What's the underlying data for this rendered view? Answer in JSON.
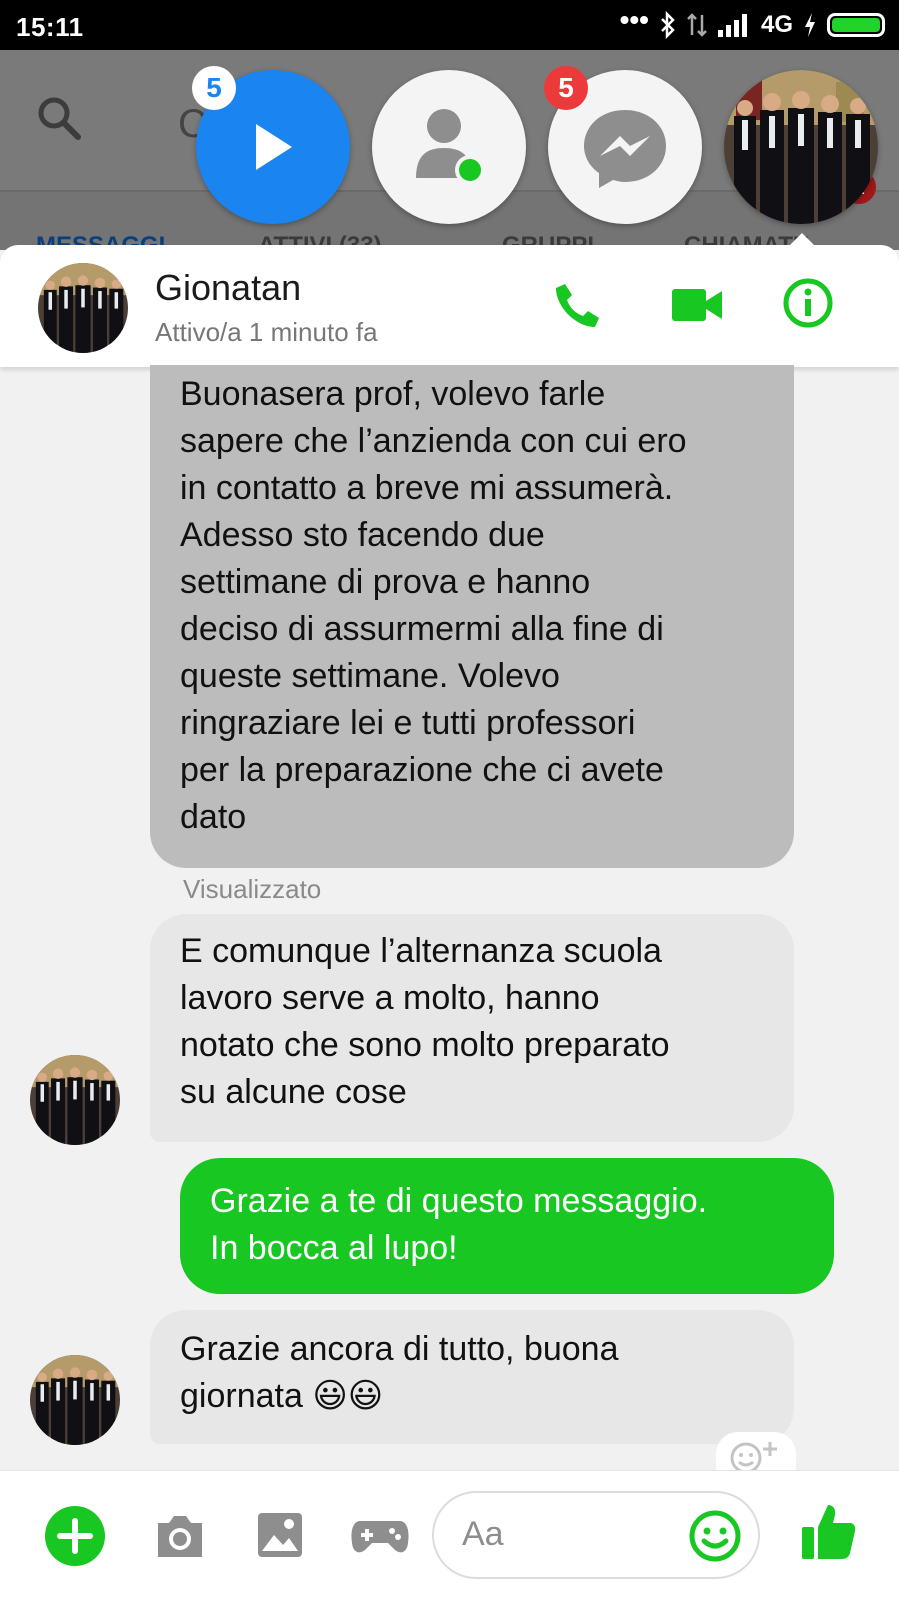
{
  "status_bar": {
    "time": "15:11",
    "dots": "•••",
    "network": "4G"
  },
  "background": {
    "tabs": [
      "MESSAGGI",
      "ATTIVI (33)",
      "GRUPPI",
      "CHIAMATE"
    ],
    "search_letter": "C",
    "calls_badge": "1"
  },
  "chat_heads": {
    "play_badge": "5",
    "messenger_badge": "5"
  },
  "header": {
    "name": "Gionatan",
    "status": "Attivo/a 1 minuto fa"
  },
  "messages": [
    {
      "from": "them",
      "text": "Buonasera prof, volevo farle\nsapere che l’anzienda con cui ero\nin contatto a breve mi assumerà.\nAdesso sto facendo due\nsettimane di prova e hanno\ndeciso di assurmermi alla fine di\nqueste settimane. Volevo\nringraziare lei e tutti professori\nper la preparazione che ci avete\ndato"
    },
    {
      "from": "them",
      "text": "E comunque l’alternanza scuola\nlavoro serve a molto, hanno\nnotato che sono molto preparato\nsu alcune cose"
    },
    {
      "from": "me",
      "text": "Grazie a te di questo messaggio.\nIn bocca al lupo!"
    },
    {
      "from": "them",
      "text": "Grazie ancora di tutto, buona\ngiornata 😃😃"
    }
  ],
  "seen_label": "Visualizzato",
  "composer": {
    "placeholder": "Aa"
  },
  "colors": {
    "accent": "#18c722",
    "messenger_blue": "#1a84f0",
    "badge_red": "#ec3a3a"
  }
}
